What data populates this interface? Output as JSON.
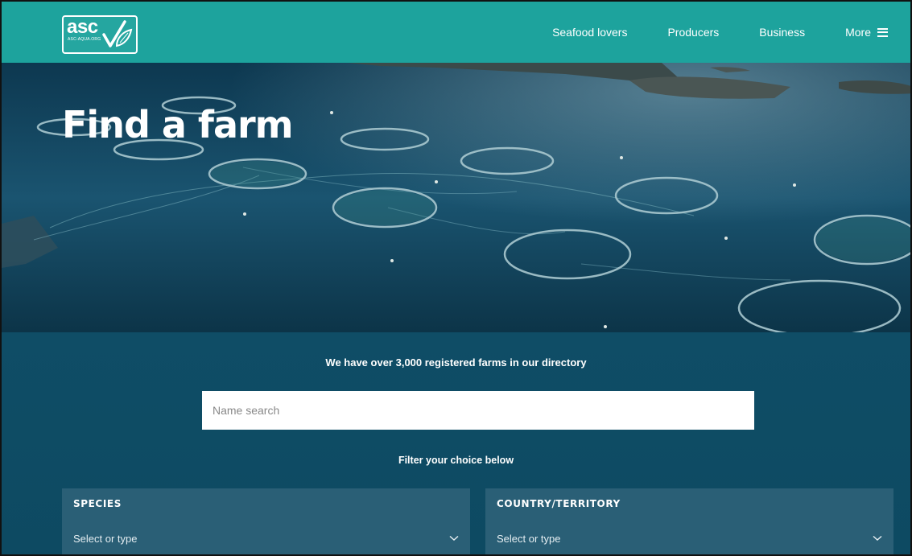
{
  "header": {
    "logo_text": "asc",
    "logo_sub": "ASC-AQUA.ORG",
    "nav": [
      {
        "label": "Seafood lovers"
      },
      {
        "label": "Producers"
      },
      {
        "label": "Business"
      },
      {
        "label": "More"
      }
    ]
  },
  "hero": {
    "title": "Find a farm"
  },
  "search": {
    "tagline": "We have over 3,000 registered farms in our directory",
    "name_placeholder": "Name search",
    "filter_label": "Filter your choice below",
    "filters": [
      {
        "title": "SPECIES",
        "placeholder": "Select or type"
      },
      {
        "title": "COUNTRY/TERRITORY",
        "placeholder": "Select or type"
      }
    ]
  },
  "colors": {
    "header_bg": "#1da39d",
    "section_bg": "#0f4d66",
    "filter_bg": "#2a5f76"
  },
  "icons": [
    "asc-logo-icon",
    "menu-icon",
    "chevron-down-icon"
  ]
}
